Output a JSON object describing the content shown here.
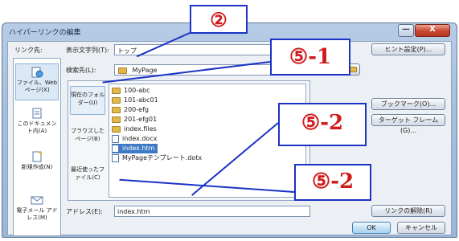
{
  "dialog": {
    "title": "ハイパーリンクの編集",
    "minimize_glyph": "—",
    "close_glyph": "X"
  },
  "link_to_label": "リンク先:",
  "display_text": {
    "label": "表示文字列(T):",
    "value": "トップ"
  },
  "screentip_button": "ヒント設定(P)...",
  "look_in": {
    "label": "検索先(L):",
    "value": "MyPage"
  },
  "sidebar": {
    "items": [
      {
        "label": "ファイル、Web ページ(X)",
        "icon": "globe-file-icon",
        "selected": true
      },
      {
        "label": "このドキュメント内(A)",
        "icon": "document-icon",
        "selected": false
      },
      {
        "label": "新規作成(N)",
        "icon": "new-document-icon",
        "selected": false
      },
      {
        "label": "電子メール アドレス(M)",
        "icon": "email-icon",
        "selected": false
      }
    ]
  },
  "inner_nav": {
    "items": [
      {
        "label": "現在のフォルダー(U)",
        "selected": true
      },
      {
        "label": "ブラウズしたページ(B)",
        "selected": false
      },
      {
        "label": "最近使ったファイル(C)",
        "selected": false
      }
    ]
  },
  "files": [
    {
      "name": "100-abc",
      "type": "folder"
    },
    {
      "name": "101-abc01",
      "type": "folder"
    },
    {
      "name": "200-efg",
      "type": "folder"
    },
    {
      "name": "201-efg01",
      "type": "folder"
    },
    {
      "name": "index.files",
      "type": "folder"
    },
    {
      "name": "index.docx",
      "type": "file"
    },
    {
      "name": "index.htm",
      "type": "file",
      "selected": true
    },
    {
      "name": "MyPageテンプレート.dotx",
      "type": "file"
    }
  ],
  "right_buttons": {
    "bookmark": "ブックマーク(O)...",
    "target_frame": "ターゲット フレーム(G)..."
  },
  "address": {
    "label": "アドレス(E):",
    "value": "index.htm"
  },
  "remove_link_button": "リンクの解除(R)",
  "ok_button": "OK",
  "cancel_button": "キャンセル",
  "callouts": {
    "c1": "②",
    "c2": "⑤-1",
    "c3": "⑤-2",
    "c4": "⑤-2"
  },
  "colors": {
    "callout_border": "#1a33c5",
    "callout_text": "#d11b1b",
    "selection": "#3d79c4"
  }
}
